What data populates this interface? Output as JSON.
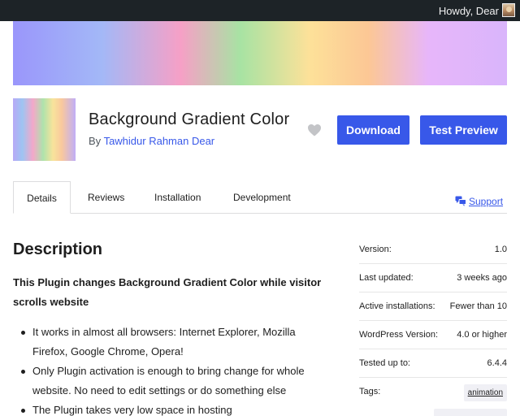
{
  "adminbar": {
    "greeting": "Howdy, Dear"
  },
  "plugin": {
    "title": "Background Gradient Color",
    "by": "By",
    "author": "Tawhidur Rahman Dear"
  },
  "actions": {
    "download": "Download",
    "preview": "Test Preview"
  },
  "tabs": [
    {
      "label": "Details"
    },
    {
      "label": "Reviews"
    },
    {
      "label": "Installation"
    },
    {
      "label": "Development"
    }
  ],
  "support": {
    "label": "Support"
  },
  "description": {
    "heading": "Description",
    "intro": "This Plugin changes Background Gradient Color while visitor scrolls website",
    "features": [
      "It works in almost all browsers: Internet Explorer, Mozilla Firefox, Google Chrome, Opera!",
      "Only Plugin activation is enough to bring change for whole website. No need to edit settings or do something else",
      "The Plugin takes very low space in hosting"
    ]
  },
  "meta": [
    {
      "key": "Version:",
      "value": "1.0"
    },
    {
      "key": "Last updated:",
      "value": "3 weeks ago"
    },
    {
      "key": "Active installations:",
      "value": "Fewer than 10"
    },
    {
      "key": "WordPress Version:",
      "value": "4.0 or higher"
    },
    {
      "key": "Tested up to:",
      "value": "6.4.4"
    },
    {
      "key": "Tags:",
      "value": ""
    }
  ],
  "tags": [
    "animation"
  ],
  "colors": {
    "accent": "#3858e9",
    "adminbar": "#1d2327"
  },
  "icons": {
    "favorite": "heart-icon",
    "support": "chat-bubbles-icon",
    "avatar": "user-avatar"
  }
}
